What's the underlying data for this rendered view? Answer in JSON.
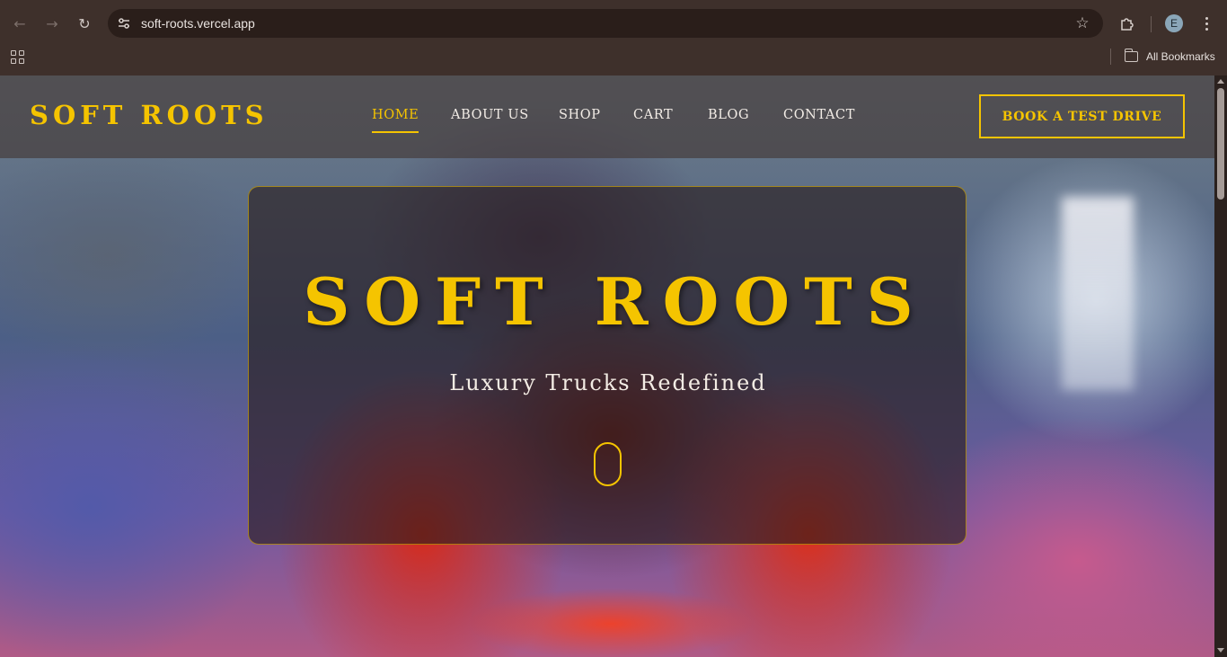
{
  "browser": {
    "url": "soft-roots.vercel.app",
    "avatar_initial": "E",
    "bookmarks_label": "All Bookmarks",
    "icons": {
      "back": "arrow-left-icon",
      "forward": "arrow-right-icon",
      "reload": "reload-icon",
      "site_info": "tune-icon",
      "bookmark": "star-icon",
      "extensions": "puzzle-icon",
      "menu": "kebab-menu-icon",
      "apps": "apps-grid-icon",
      "folder": "folder-icon"
    }
  },
  "site": {
    "brand": "SOFT ROOTS",
    "nav": [
      {
        "label": "HOME",
        "active": true
      },
      {
        "label": "ABOUT US",
        "active": false
      },
      {
        "label": "SHOP",
        "active": false
      },
      {
        "label": "CART",
        "active": false
      },
      {
        "label": "BLOG",
        "active": false
      },
      {
        "label": "CONTACT",
        "active": false
      }
    ],
    "cta_label": "BOOK A TEST DRIVE",
    "hero": {
      "title": "SOFT ROOTS",
      "subtitle": "Luxury Trucks Redefined"
    },
    "colors": {
      "accent": "#f5c400",
      "header_bg": "#463e3e",
      "chrome_bg": "#3e302b"
    }
  }
}
